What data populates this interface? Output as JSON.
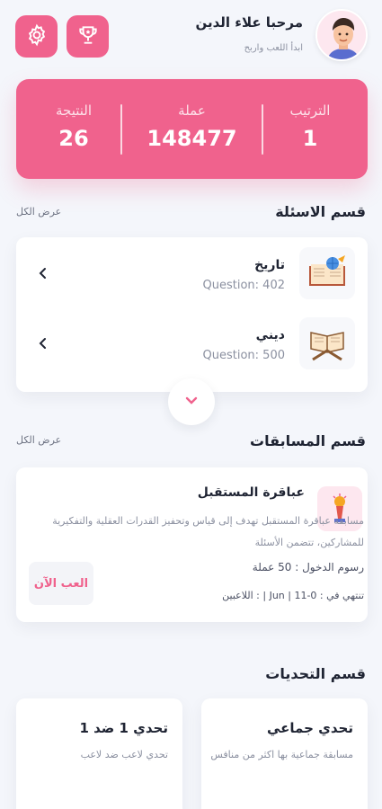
{
  "header": {
    "greeting": "مرحبا علاء الدين",
    "subtitle": "ابدأ اللعب واربح",
    "settings_icon": "gear-icon",
    "trophy_icon": "trophy-icon"
  },
  "stats": {
    "rank": {
      "label": "الترتيب",
      "value": "1"
    },
    "coins": {
      "label": "عملة",
      "value": "148477"
    },
    "score": {
      "label": "النتيجة",
      "value": "26"
    }
  },
  "questions_section": {
    "title": "قسم الاسئلة",
    "see_all": "عرض الكل",
    "items": [
      {
        "title": "تاريخ",
        "count": "Question: 402",
        "icon": "history-book-icon"
      },
      {
        "title": "ديني",
        "count": "Question: 500",
        "icon": "quran-icon"
      }
    ]
  },
  "competitions_section": {
    "title": "قسم المسابقات",
    "see_all": "عرض الكل",
    "item": {
      "title": "عباقرة المستقبل",
      "description": "مسابقة عباقرة المستقبل تهدف إلى قياس وتحفيز القدرات العقلية والتفكيرية للمشاركين، تتضمن الأسئلة",
      "entry_fee": "رسوم الدخول : 50 عملة",
      "ends": "تنتهي في : Jun | 11-0 | : اللاعبين",
      "play_label": "العب الآن"
    }
  },
  "challenges_section": {
    "title": "قسم التحديات",
    "items": [
      {
        "title": "تحدي جماعي",
        "description": "مسابقة جماعية بها اكثر من منافس"
      },
      {
        "title": "تحدي 1 ضد 1",
        "description": "تحدي لاعب ضد لاعب"
      }
    ]
  },
  "colors": {
    "accent": "#f0628d",
    "background": "#f4f6fb"
  }
}
